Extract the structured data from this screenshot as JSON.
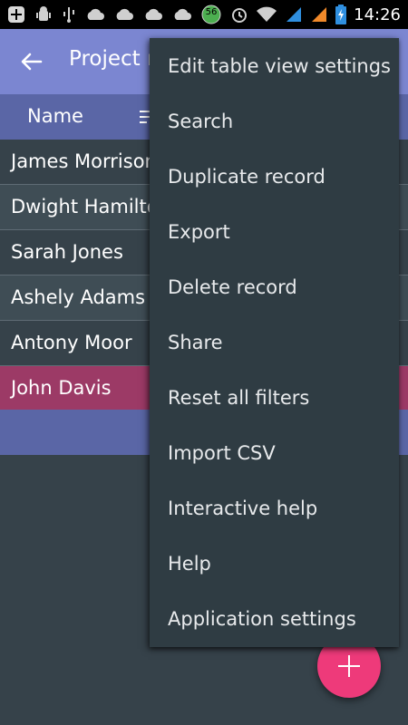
{
  "status_bar": {
    "time": "14:26",
    "battery_badge": "56",
    "icons": [
      "add-icon",
      "android-debug-icon",
      "usb-icon",
      "cloud-icon",
      "cloud-icon",
      "cloud-icon",
      "cloud-icon",
      "notification-badge-icon",
      "alarm-icon",
      "wifi-icon",
      "signal-icon",
      "signal-icon",
      "battery-charging-icon"
    ]
  },
  "app_bar": {
    "title": "Project m"
  },
  "table": {
    "column_name": "Name",
    "rows": [
      {
        "name": "James Morrison"
      },
      {
        "name": "Dwight Hamilton"
      },
      {
        "name": "Sarah Jones"
      },
      {
        "name": "Ashely Adams"
      },
      {
        "name": "Antony Moor"
      },
      {
        "name": "John Davis"
      }
    ]
  },
  "menu": {
    "items": [
      "Edit table view settings",
      "Search",
      "Duplicate record",
      "Export",
      "Delete record",
      "Share",
      "Reset all filters",
      "Import CSV",
      "Interactive help",
      "Help",
      "Application settings"
    ]
  },
  "colors": {
    "app_bar": "#7b86d1",
    "table_header": "#5a66a6",
    "selected_row": "#9c3a66",
    "background": "#36424a",
    "menu_bg": "#2f3c43",
    "fab": "#ee3a7a"
  }
}
